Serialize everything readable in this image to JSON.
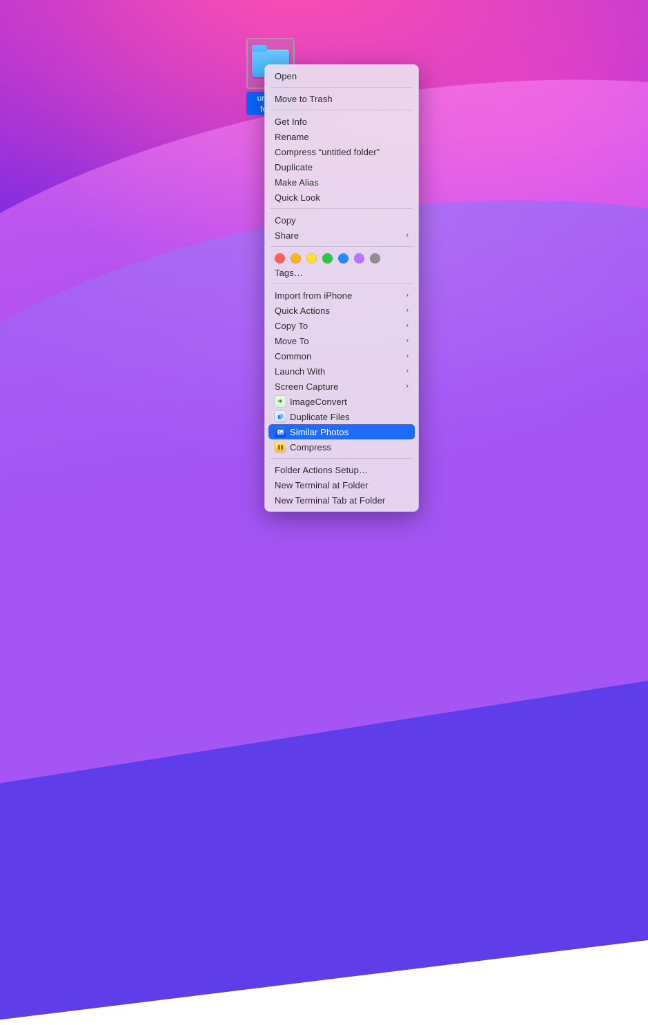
{
  "folder": {
    "label": "untitled folder"
  },
  "menu": {
    "open": "Open",
    "trash": "Move to Trash",
    "getinfo": "Get Info",
    "rename": "Rename",
    "compress": "Compress “untitled folder”",
    "duplicate": "Duplicate",
    "alias": "Make Alias",
    "quicklook": "Quick Look",
    "copy": "Copy",
    "share": "Share",
    "tagsmore": "Tags…",
    "importIphone": "Import from iPhone",
    "quickActions": "Quick Actions",
    "copyTo": "Copy To",
    "moveTo": "Move To",
    "common": "Common",
    "launchWith": "Launch With",
    "screenCapture": "Screen Capture",
    "svcImageConvert": "ImageConvert",
    "svcDuplicateFiles": "Duplicate Files",
    "svcSimilarPhotos": "Similar Photos",
    "svcCompress": "Compress",
    "folderActions": "Folder Actions Setup…",
    "newTerminal": "New Terminal at Folder",
    "newTerminalTab": "New Terminal Tab at Folder"
  },
  "tags": {
    "colors": [
      "#ff5f57",
      "#ffb020",
      "#ffde2f",
      "#28c840",
      "#1e8bff",
      "#b975ff",
      "#8e8e93"
    ]
  },
  "highlighted_item": "svcSimilarPhotos"
}
